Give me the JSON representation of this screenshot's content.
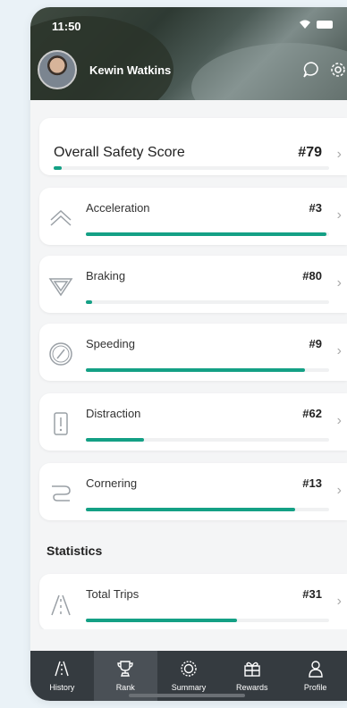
{
  "status_bar": {
    "time": "11:50"
  },
  "header": {
    "user_name": "Kewin Watkins"
  },
  "overall": {
    "label": "Overall Safety Score",
    "rank": "#79",
    "progress": 0.03
  },
  "metrics": [
    {
      "label": "Acceleration",
      "rank": "#3",
      "progress": 0.99,
      "icon": "chevrons-up-icon"
    },
    {
      "label": "Braking",
      "rank": "#80",
      "progress": 0.02,
      "icon": "triangle-down-icon"
    },
    {
      "label": "Speeding",
      "rank": "#9",
      "progress": 0.9,
      "icon": "speedometer-icon"
    },
    {
      "label": "Distraction",
      "rank": "#62",
      "progress": 0.24,
      "icon": "exclamation-box-icon"
    },
    {
      "label": "Cornering",
      "rank": "#13",
      "progress": 0.86,
      "icon": "curve-road-icon"
    }
  ],
  "statistics": {
    "title": "Statistics",
    "items": [
      {
        "label": "Total Trips",
        "rank": "#31",
        "progress": 0.62,
        "icon": "road-icon"
      }
    ]
  },
  "tabs": [
    {
      "label": "History",
      "icon": "road-icon"
    },
    {
      "label": "Rank",
      "icon": "trophy-icon",
      "active": true
    },
    {
      "label": "Summary",
      "icon": "ring-icon"
    },
    {
      "label": "Rewards",
      "icon": "gift-icon"
    },
    {
      "label": "Profile",
      "icon": "person-icon"
    }
  ],
  "colors": {
    "accent": "#14a085",
    "tabbar": "#353b40"
  }
}
